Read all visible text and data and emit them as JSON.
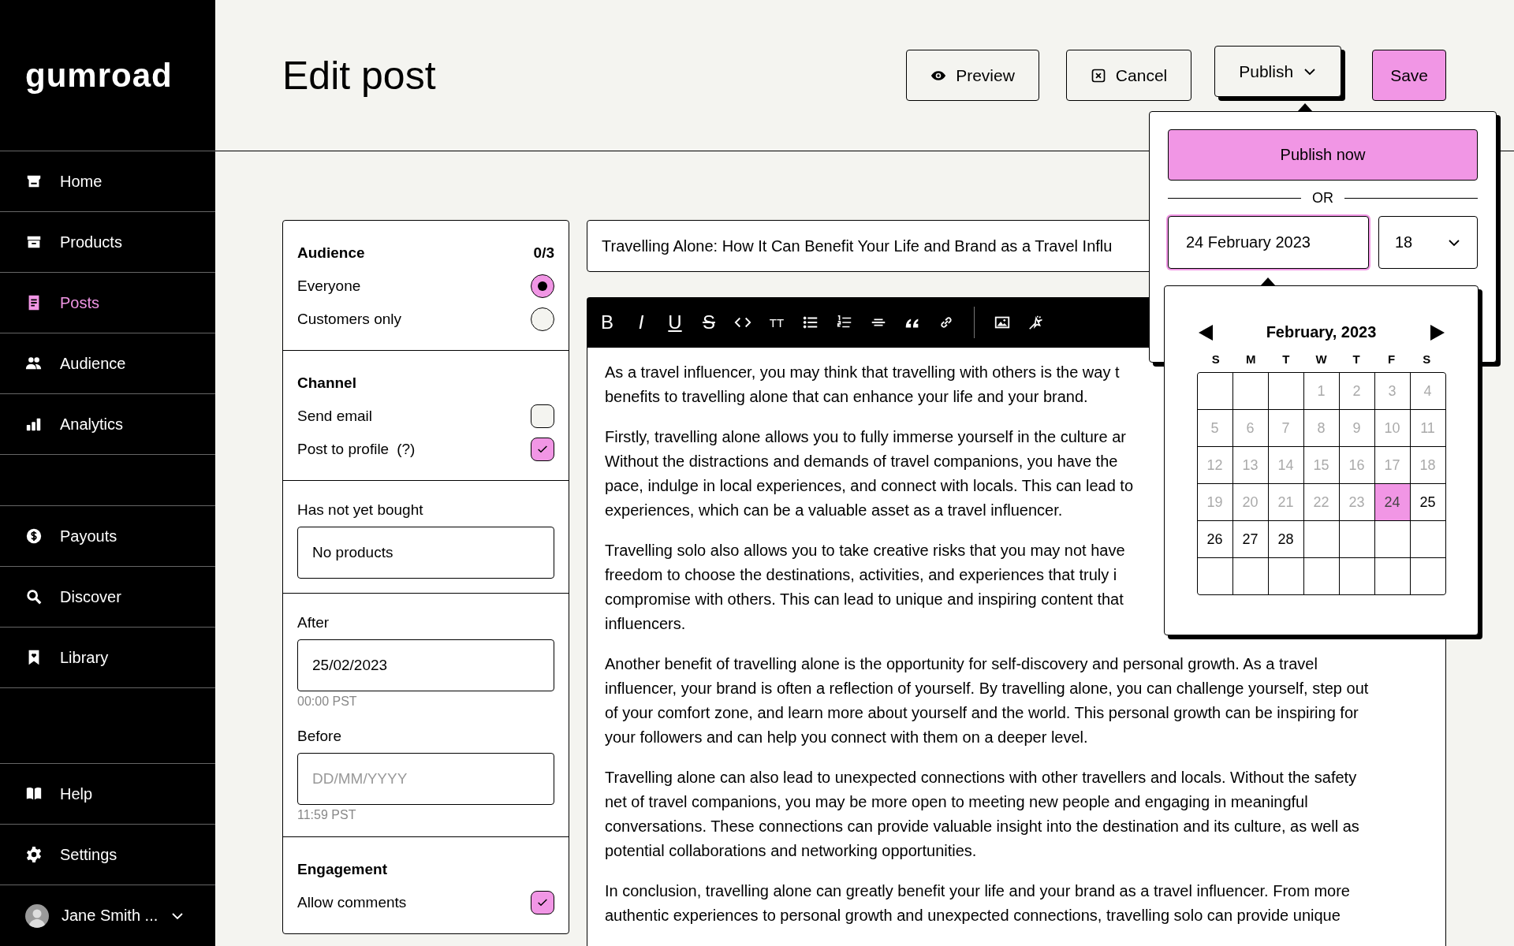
{
  "sidebar": {
    "logo": "gumroad",
    "nav_sections": [
      {
        "items": [
          {
            "label": "Home",
            "selected": false
          },
          {
            "label": "Products",
            "selected": false
          },
          {
            "label": "Posts",
            "selected": true
          },
          {
            "label": "Audience",
            "selected": false
          },
          {
            "label": "Analytics",
            "selected": false
          }
        ]
      },
      {
        "items": [
          {
            "label": "Payouts",
            "selected": false
          },
          {
            "label": "Discover",
            "selected": false
          },
          {
            "label": "Library",
            "selected": false
          }
        ]
      },
      {
        "items": [
          {
            "label": "Help",
            "selected": false
          },
          {
            "label": "Settings",
            "selected": false
          }
        ]
      }
    ],
    "user": {
      "name": "Jane Smith ..."
    }
  },
  "header": {
    "title": "Edit post",
    "buttons": [
      {
        "label": "Preview",
        "kind": "preview"
      },
      {
        "label": "Cancel",
        "kind": "cancel"
      },
      {
        "label": "Publish",
        "kind": "menu",
        "expanded": true
      },
      {
        "label": "Save",
        "kind": "primary"
      }
    ]
  },
  "settings_panel": {
    "audience": {
      "heading": "Audience",
      "count": "0/3",
      "options": [
        {
          "label": "Everyone",
          "selected": true
        },
        {
          "label": "Customers only",
          "selected": false
        }
      ]
    },
    "channel": {
      "heading": "Channel",
      "options": [
        {
          "label": "Send email",
          "checked": false
        },
        {
          "label": "Post to profile",
          "help_mark": "(?)",
          "checked": true
        }
      ]
    },
    "purchase_filter": {
      "label": "Has not yet bought",
      "value": "No products"
    },
    "date_filters": [
      {
        "label": "After",
        "value": "25/02/2023",
        "hint": "00:00 PST"
      },
      {
        "label": "Before",
        "placeholder": "DD/MM/YYYY",
        "hint": "11:59 PST"
      }
    ],
    "engagement": {
      "heading": "Engagement",
      "options": [
        {
          "label": "Allow comments",
          "checked": true
        }
      ]
    }
  },
  "editor": {
    "title_value": "Travelling Alone: How It Can Benefit Your Life and Brand as a Travel Influ",
    "toolbar": [
      {
        "kind": "bold",
        "label": "B"
      },
      {
        "kind": "italic",
        "label": "I"
      },
      {
        "kind": "underline",
        "label": "U"
      },
      {
        "kind": "strike",
        "label": "S"
      },
      {
        "kind": "code"
      },
      {
        "kind": "size",
        "label": "TT"
      },
      {
        "kind": "bullets"
      },
      {
        "kind": "numbers"
      },
      {
        "kind": "rule"
      },
      {
        "kind": "quote"
      },
      {
        "kind": "link"
      },
      {
        "kind": "separator"
      },
      {
        "kind": "image"
      },
      {
        "kind": "sparkle"
      }
    ],
    "paragraphs": [
      {
        "lines": [
          "As a travel influencer, you may think that travelling with others is the way t",
          "benefits to travelling alone that can enhance your life and your brand."
        ]
      },
      {
        "lines": [
          "Firstly, travelling alone allows you to fully immerse yourself in the culture ar",
          "Without the distractions and demands of travel companions, you have the",
          "pace, indulge in local experiences, and connect with locals. This can lead to",
          "experiences, which can be a valuable asset as a travel influencer."
        ]
      },
      {
        "lines": [
          "Travelling solo also allows you to take creative risks that you may not have",
          "freedom to choose the destinations, activities, and experiences that truly i",
          "compromise with others. This can lead to unique and inspiring content that",
          "influencers."
        ]
      },
      {
        "lines": [
          "Another benefit of travelling alone is the opportunity for self-discovery and personal growth. As a travel",
          "influencer, your brand is often a reflection of yourself. By travelling alone, you can challenge yourself, step out",
          "of your comfort zone, and learn more about yourself and the world. This personal growth can be inspiring for",
          "your followers and can help you connect with them on a deeper level."
        ]
      },
      {
        "lines": [
          "Travelling alone can also lead to unexpected connections with other travellers and locals. Without the safety",
          "net of travel companions, you may be more open to meeting new people and engaging in meaningful",
          "conversations. These connections can provide valuable insight into the destination and its culture, as well as",
          "potential collaborations and networking opportunities."
        ]
      },
      {
        "lines": [
          "In conclusion, travelling alone can greatly benefit your life and your brand as a travel influencer. From more",
          "authentic experiences to personal growth and unexpected connections, travelling solo can provide unique"
        ]
      }
    ]
  },
  "publish_menu": {
    "publish_now": "Publish now",
    "divider_label": "OR",
    "date_value": "24 February 2023",
    "hour_value": "18"
  },
  "calendar": {
    "title": "February, 2023",
    "weekdays": [
      "S",
      "M",
      "T",
      "W",
      "T",
      "F",
      "S"
    ],
    "weeks": [
      [
        {
          "kind": "blank"
        },
        {
          "kind": "blank"
        },
        {
          "kind": "blank"
        },
        {
          "kind": "day",
          "day": "1",
          "disabled": true,
          "selected": false
        },
        {
          "kind": "day",
          "day": "2",
          "disabled": true,
          "selected": false
        },
        {
          "kind": "day",
          "day": "3",
          "disabled": true,
          "selected": false
        },
        {
          "kind": "day",
          "day": "4",
          "disabled": true,
          "selected": false
        }
      ],
      [
        {
          "kind": "day",
          "day": "5",
          "disabled": true,
          "selected": false
        },
        {
          "kind": "day",
          "day": "6",
          "disabled": true,
          "selected": false
        },
        {
          "kind": "day",
          "day": "7",
          "disabled": true,
          "selected": false
        },
        {
          "kind": "day",
          "day": "8",
          "disabled": true,
          "selected": false
        },
        {
          "kind": "day",
          "day": "9",
          "disabled": true,
          "selected": false
        },
        {
          "kind": "day",
          "day": "10",
          "disabled": true,
          "selected": false
        },
        {
          "kind": "day",
          "day": "11",
          "disabled": true,
          "selected": false
        }
      ],
      [
        {
          "kind": "day",
          "day": "12",
          "disabled": true,
          "selected": false
        },
        {
          "kind": "day",
          "day": "13",
          "disabled": true,
          "selected": false
        },
        {
          "kind": "day",
          "day": "14",
          "disabled": true,
          "selected": false
        },
        {
          "kind": "day",
          "day": "15",
          "disabled": true,
          "selected": false
        },
        {
          "kind": "day",
          "day": "16",
          "disabled": true,
          "selected": false
        },
        {
          "kind": "day",
          "day": "17",
          "disabled": true,
          "selected": false
        },
        {
          "kind": "day",
          "day": "18",
          "disabled": true,
          "selected": false
        }
      ],
      [
        {
          "kind": "day",
          "day": "19",
          "disabled": true,
          "selected": false
        },
        {
          "kind": "day",
          "day": "20",
          "disabled": true,
          "selected": false
        },
        {
          "kind": "day",
          "day": "21",
          "disabled": true,
          "selected": false
        },
        {
          "kind": "day",
          "day": "22",
          "disabled": true,
          "selected": false
        },
        {
          "kind": "day",
          "day": "23",
          "disabled": true,
          "selected": false
        },
        {
          "kind": "day",
          "day": "24",
          "disabled": true,
          "selected": true
        },
        {
          "kind": "day",
          "day": "25",
          "disabled": false,
          "selected": false
        }
      ],
      [
        {
          "kind": "day",
          "day": "26",
          "disabled": false,
          "selected": false
        },
        {
          "kind": "day",
          "day": "27",
          "disabled": false,
          "selected": false
        },
        {
          "kind": "day",
          "day": "28",
          "disabled": false,
          "selected": false
        },
        {
          "kind": "blank"
        },
        {
          "kind": "blank"
        },
        {
          "kind": "blank"
        },
        {
          "kind": "blank"
        }
      ],
      [
        {
          "kind": "blank"
        },
        {
          "kind": "blank"
        },
        {
          "kind": "blank"
        },
        {
          "kind": "blank"
        },
        {
          "kind": "blank"
        },
        {
          "kind": "blank"
        },
        {
          "kind": "blank"
        }
      ]
    ]
  }
}
